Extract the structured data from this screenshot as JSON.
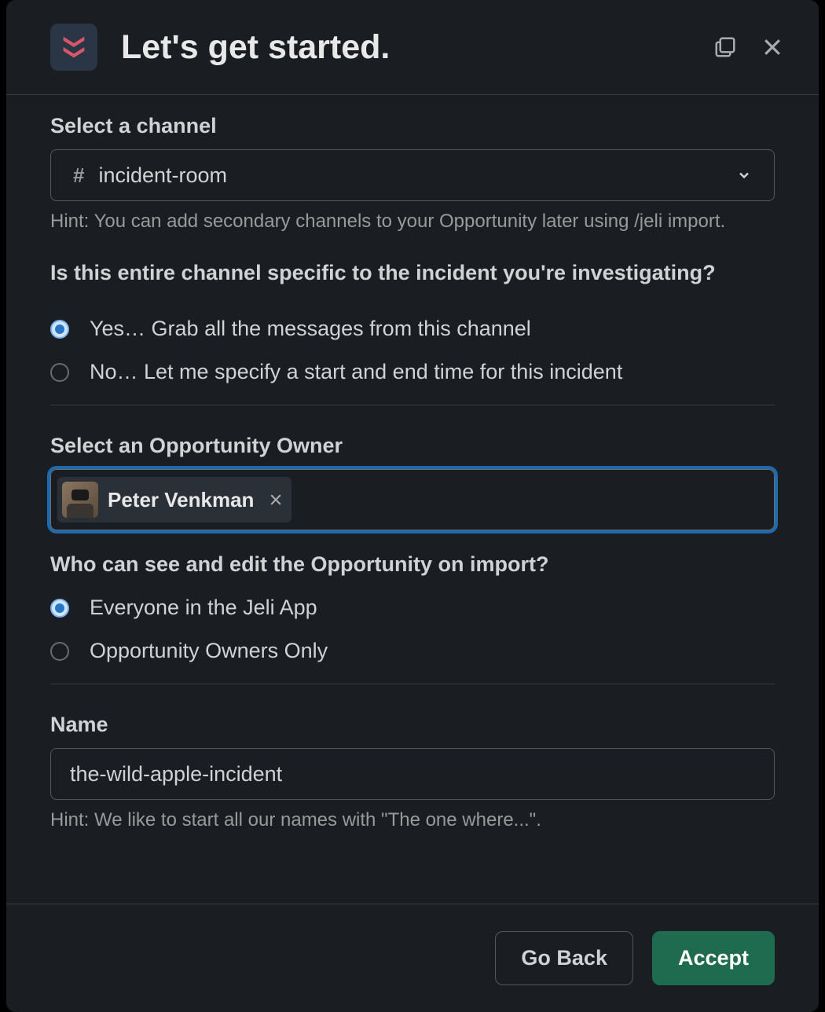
{
  "header": {
    "title": "Let's get started."
  },
  "channel": {
    "label": "Select a channel",
    "selected": "incident-room",
    "hint": "Hint: You can add secondary channels to your Opportunity later using /jeli import."
  },
  "scope": {
    "question": "Is this entire channel specific to the incident you're investigating?",
    "options": [
      "Yes… Grab all the messages from this channel",
      "No… Let me specify a start and end time for this incident"
    ],
    "selected_index": 0
  },
  "owner": {
    "label": "Select an Opportunity Owner",
    "chip_name": "Peter Venkman"
  },
  "visibility": {
    "question": "Who can see and edit the Opportunity on import?",
    "options": [
      "Everyone in the Jeli App",
      "Opportunity Owners Only"
    ],
    "selected_index": 0
  },
  "name": {
    "label": "Name",
    "value": "the-wild-apple-incident",
    "hint": "Hint: We like to start all our names with \"The one where...\"."
  },
  "footer": {
    "back_label": "Go Back",
    "accept_label": "Accept"
  }
}
